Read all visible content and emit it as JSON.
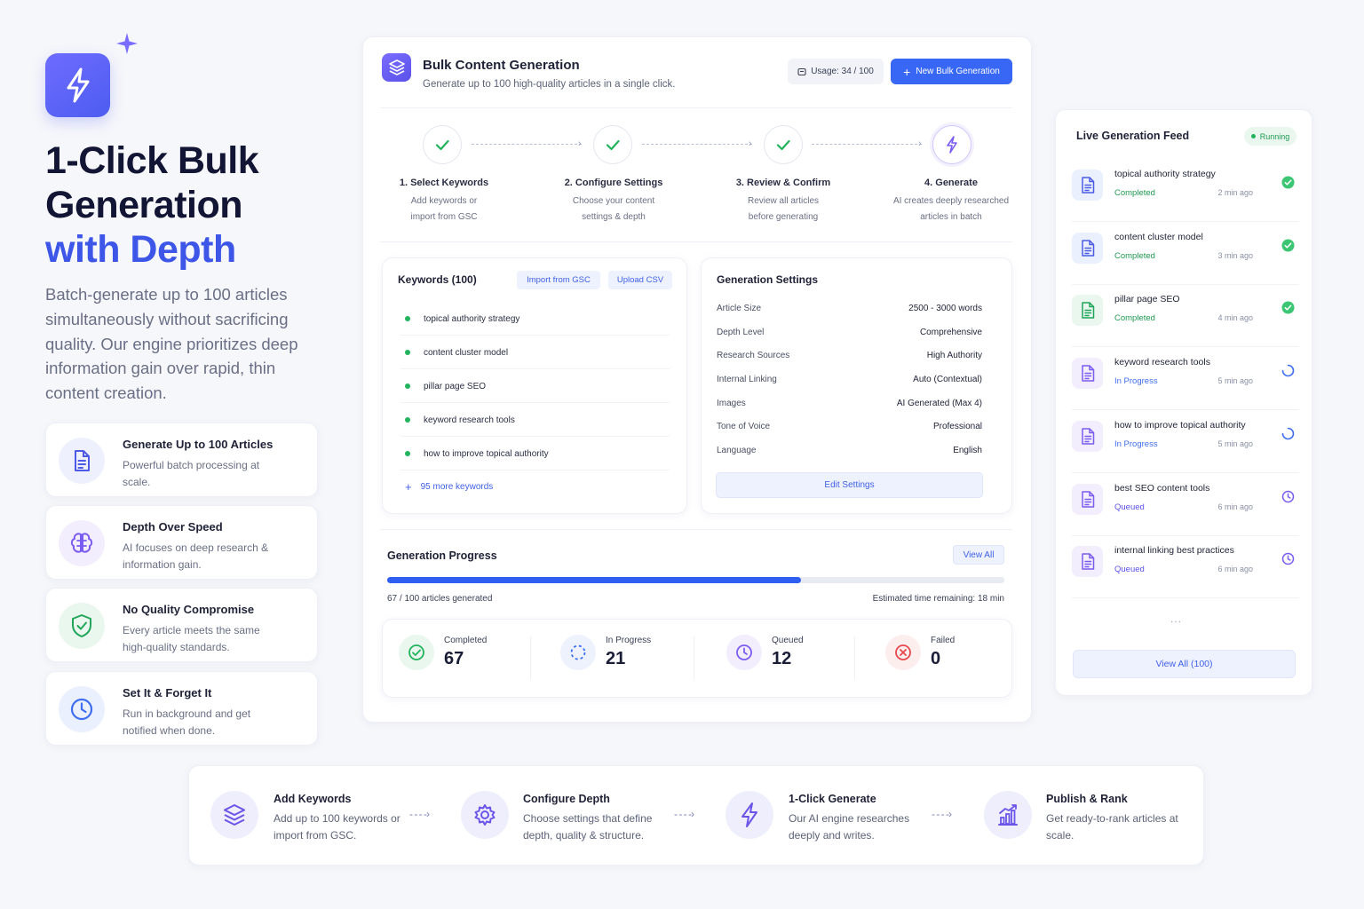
{
  "hero": {
    "title_line1": "1-Click Bulk",
    "title_line2": "Generation",
    "title_accent": "with Depth",
    "subtitle": "Batch-generate up to 100 articles simultaneously without sacrificing quality. Our engine prioritizes deep information gain over rapid, thin content creation.",
    "features": [
      {
        "title": "Generate Up to 100 Articles",
        "desc": "Powerful batch processing at scale.",
        "icon": "document-icon"
      },
      {
        "title": "Depth Over Speed",
        "desc": "AI focuses on deep research & information gain.",
        "icon": "brain-icon"
      },
      {
        "title": "No Quality Compromise",
        "desc": "Every article meets the same high-quality standards.",
        "icon": "shield-check-icon"
      },
      {
        "title": "Set It & Forget It",
        "desc": "Run in background and get notified when done.",
        "icon": "clock-icon"
      }
    ]
  },
  "panel": {
    "title": "Bulk Content Generation",
    "subtitle": "Generate up to 100 high-quality articles in a single click.",
    "usage": "Usage: 34 / 100",
    "new_button": "New Bulk Generation",
    "steps": [
      {
        "title": "1. Select Keywords",
        "desc1": "Add keywords or",
        "desc2": "import from GSC",
        "state": "done"
      },
      {
        "title": "2. Configure Settings",
        "desc1": "Choose your content",
        "desc2": "settings & depth",
        "state": "done"
      },
      {
        "title": "3. Review & Confirm",
        "desc1": "Review all articles",
        "desc2": "before generating",
        "state": "done"
      },
      {
        "title": "4. Generate",
        "desc1": "AI creates deeply researched",
        "desc2": "articles in batch",
        "state": "active"
      }
    ]
  },
  "keywords": {
    "title": "Keywords (100)",
    "import_label": "Import from GSC",
    "upload_label": "Upload CSV",
    "items": [
      "topical authority strategy",
      "content cluster model",
      "pillar page SEO",
      "keyword research tools",
      "how to improve topical authority"
    ],
    "more": "95 more keywords"
  },
  "settings": {
    "title": "Generation Settings",
    "rows": [
      {
        "label": "Article Size",
        "value": "2500 - 3000 words"
      },
      {
        "label": "Depth Level",
        "value": "Comprehensive"
      },
      {
        "label": "Research Sources",
        "value": "High Authority"
      },
      {
        "label": "Internal Linking",
        "value": "Auto (Contextual)"
      },
      {
        "label": "Images",
        "value": "AI Generated (Max 4)"
      },
      {
        "label": "Tone of Voice",
        "value": "Professional"
      },
      {
        "label": "Language",
        "value": "English"
      }
    ],
    "edit_label": "Edit Settings"
  },
  "progress": {
    "title": "Generation Progress",
    "view_all": "View All",
    "fraction": 0.67,
    "text": "67 / 100 articles generated",
    "eta": "Estimated time remaining: 18 min",
    "stats": [
      {
        "label": "Completed",
        "value": "67",
        "color": "#21b45d"
      },
      {
        "label": "In Progress",
        "value": "21",
        "color": "#3f6ef0"
      },
      {
        "label": "Queued",
        "value": "12",
        "color": "#7b5cf0"
      },
      {
        "label": "Failed",
        "value": "0",
        "color": "#e5484d"
      }
    ]
  },
  "feed": {
    "title": "Live Generation Feed",
    "status": "Running",
    "items": [
      {
        "name": "topical authority strategy",
        "status": "Completed",
        "time": "2 min ago"
      },
      {
        "name": "content cluster model",
        "status": "Completed",
        "time": "3 min ago"
      },
      {
        "name": "pillar page SEO",
        "status": "Completed",
        "time": "4 min ago"
      },
      {
        "name": "keyword research tools",
        "status": "In Progress",
        "time": "5 min ago"
      },
      {
        "name": "how to improve topical authority",
        "status": "In Progress",
        "time": "5 min ago"
      },
      {
        "name": "best SEO content tools",
        "status": "Queued",
        "time": "6 min ago"
      },
      {
        "name": "internal linking best practices",
        "status": "Queued",
        "time": "6 min ago"
      }
    ],
    "ellipsis": "...",
    "view_all": "View All (100)"
  },
  "flow": [
    {
      "title": "Add Keywords",
      "desc": "Add up to 100 keywords or import from GSC.",
      "icon": "layers-icon"
    },
    {
      "title": "Configure Depth",
      "desc": "Choose settings that define depth, quality & structure.",
      "icon": "gear-icon"
    },
    {
      "title": "1-Click Generate",
      "desc": "Our AI engine researches deeply and writes.",
      "icon": "lightning-icon"
    },
    {
      "title": "Publish & Rank",
      "desc": "Get ready-to-rank articles at scale.",
      "icon": "chart-up-icon"
    }
  ],
  "colors": {
    "accent": "#3d56e8",
    "button": "#3767f4",
    "success": "#21b45d",
    "purple": "#7b5cf0",
    "danger": "#e5484d"
  }
}
